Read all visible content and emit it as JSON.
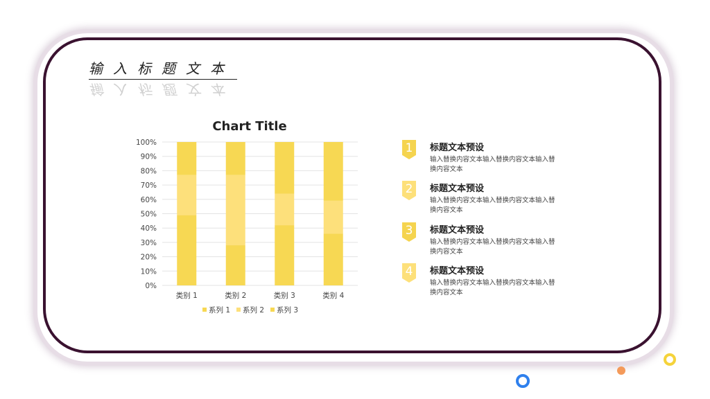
{
  "slide": {
    "title": "输入标题文本",
    "items": [
      {
        "number": "1",
        "title": "标题文本预设",
        "desc": "输入替换内容文本输入替换内容文本输入替换内容文本",
        "color": "#f5d44f"
      },
      {
        "number": "2",
        "title": "标题文本预设",
        "desc": "输入替换内容文本输入替换内容文本输入替换内容文本",
        "color": "#fde07a"
      },
      {
        "number": "3",
        "title": "标题文本预设",
        "desc": "输入替换内容文本输入替换内容文本输入替换内容文本",
        "color": "#f5d44f"
      },
      {
        "number": "4",
        "title": "标题文本预设",
        "desc": "输入替换内容文本输入替换内容文本输入替换内容文本",
        "color": "#fde07a"
      }
    ]
  },
  "colors": {
    "frame_border": "#3a1230",
    "series_1": "#f7d853",
    "series_2": "#fde07b",
    "series_3": "#f7d853",
    "circle_blue": "#2f80ed",
    "circle_yellow": "#f5d33b",
    "circle_orange": "#f49a5a"
  },
  "chart_data": {
    "type": "bar",
    "stacked": "percent",
    "title": "Chart Title",
    "categories": [
      "类别 1",
      "类别 2",
      "类别 3",
      "类别 4"
    ],
    "series": [
      {
        "name": "系列 1",
        "values": [
          49,
          28,
          42,
          36
        ]
      },
      {
        "name": "系列 2",
        "values": [
          28,
          49,
          22,
          23
        ]
      },
      {
        "name": "系列 3",
        "values": [
          23,
          23,
          36,
          41
        ]
      }
    ],
    "yticks": [
      "0%",
      "10%",
      "20%",
      "30%",
      "40%",
      "50%",
      "60%",
      "70%",
      "80%",
      "90%",
      "100%"
    ],
    "ylim": [
      0,
      100
    ],
    "grid": true,
    "legend": "bottom"
  }
}
